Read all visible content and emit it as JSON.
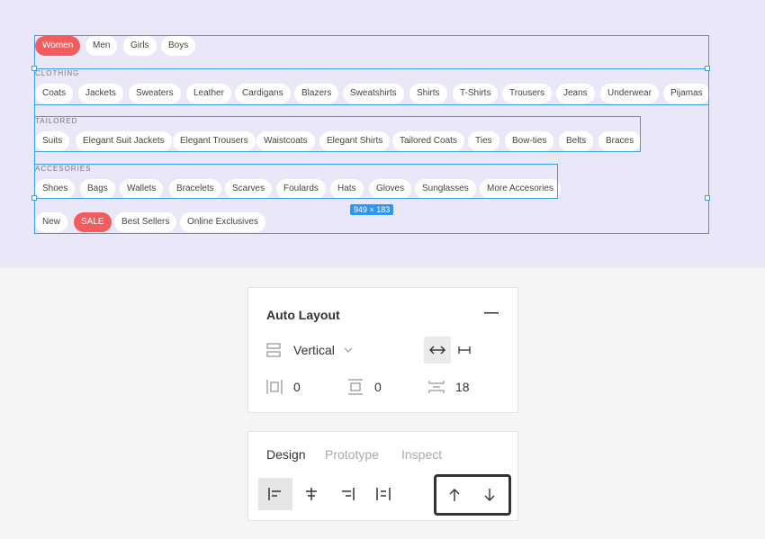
{
  "rows": [
    {
      "label": "",
      "items": [
        "Women",
        "Men",
        "Girls",
        "Boys"
      ],
      "highlight": [
        0
      ]
    },
    {
      "label": "CLOTHING",
      "items": [
        "Coats",
        "Jackets",
        "Sweaters",
        "Leather",
        "Cardigans",
        "Blazers",
        "Sweatshirts",
        "Shirts",
        "T-Shirts",
        "Trousers",
        "Jeans",
        "Underwear",
        "Pijamas"
      ],
      "highlight": []
    },
    {
      "label": "TAILORED",
      "items": [
        "Suits",
        "Elegant Suit Jackets",
        "Elegant Trousers",
        "Waistcoats",
        "Elegant Shirts",
        "Tailored Coats",
        "Ties",
        "Bow-ties",
        "Belts",
        "Braces"
      ],
      "highlight": []
    },
    {
      "label": "ACCESORIES",
      "items": [
        "Shoes",
        "Bags",
        "Wallets",
        "Bracelets",
        "Scarves",
        "Foulards",
        "Hats",
        "Gloves",
        "Sunglasses",
        "More Accesories"
      ],
      "highlight": []
    },
    {
      "label": "",
      "items": [
        "New",
        "SALE",
        "Best Sellers",
        "Online Exclusives"
      ],
      "highlight": [
        1
      ]
    }
  ],
  "selection_size": "949 × 183",
  "accent_color": "#f25c5c",
  "selection_color": "#3d9de6",
  "auto_layout": {
    "title": "Auto Layout",
    "collapse_icon": "minus-icon",
    "direction": "Vertical",
    "padding_horizontal": "0",
    "padding_vertical": "0",
    "spacing": "18"
  },
  "design_panel": {
    "tabs": [
      "Design",
      "Prototype",
      "Inspect"
    ],
    "active_tab": "Design",
    "align_icons": [
      "align-left-icon",
      "align-center-icon",
      "align-right-icon",
      "distribute-horizontal-icon"
    ],
    "arrow_icons": [
      "arrow-up-icon",
      "arrow-down-icon"
    ]
  }
}
